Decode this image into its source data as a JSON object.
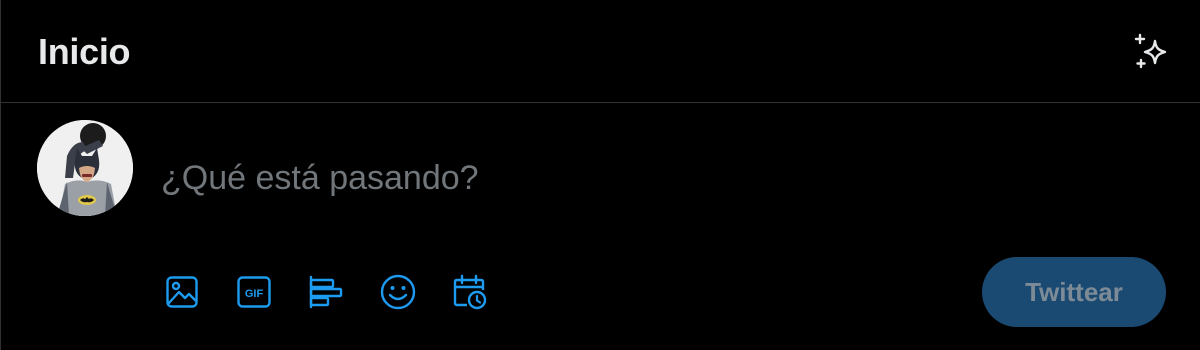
{
  "header": {
    "title": "Inicio",
    "sparkle_icon": "sparkle-icon"
  },
  "composer": {
    "avatar_icon": "batman-avatar",
    "placeholder": "¿Qué está pasando?",
    "value": "",
    "toolbar": [
      {
        "icon": "image-icon"
      },
      {
        "icon": "gif-icon",
        "label": "GIF"
      },
      {
        "icon": "poll-icon"
      },
      {
        "icon": "emoji-icon"
      },
      {
        "icon": "schedule-icon"
      }
    ],
    "submit_label": "Twittear"
  },
  "colors": {
    "background": "#000000",
    "border": "#2f3336",
    "text": "#e7e9ea",
    "placeholder": "#71767b",
    "accent": "#1d9bf0",
    "button_disabled_bg": "#1a4a72",
    "button_disabled_text": "#7d8b97"
  }
}
